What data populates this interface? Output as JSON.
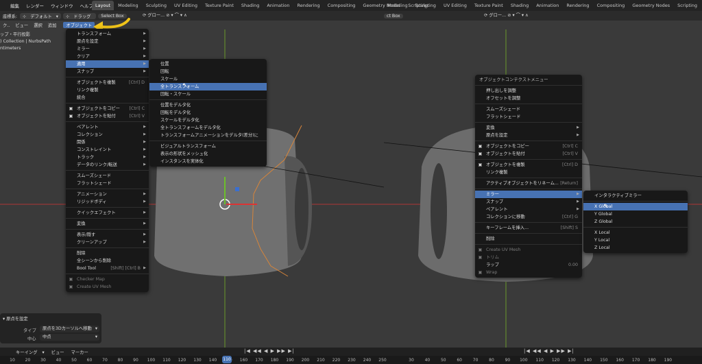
{
  "topmenu": [
    "",
    "編集",
    "レンダー",
    "ウィンドウ",
    "ヘルプ"
  ],
  "tabs": [
    "Layout",
    "Modeling",
    "Sculpting",
    "UV Editing",
    "Texture Paint",
    "Shading",
    "Animation",
    "Rendering",
    "Compositing",
    "Geometry Nodes",
    "Scripting"
  ],
  "tabs_right": [
    "Modeling",
    "Sculpting",
    "UV Editing",
    "Texture Paint",
    "Shading",
    "Animation",
    "Rendering",
    "Compositing",
    "Geometry Nodes",
    "Scripting"
  ],
  "header": {
    "coord": "座標系:",
    "pivot": "デフォルト",
    "drag": "ドラッグ",
    "select": "Select Box",
    "select_right": "ct Box",
    "global": "グロー...",
    "global2": "グロー..."
  },
  "header2": {
    "view_prefix": "ク..",
    "view": "ビュー",
    "select": "選択",
    "add": "追加",
    "object": "オブジェクト"
  },
  "viewinfo": {
    "line1": "ップ・平行投影",
    "line2": ") Collection | NurbsPath",
    "line3": "ntimeters"
  },
  "menu_object": {
    "items": [
      {
        "label": "トランスフォーム",
        "sub": true
      },
      {
        "label": "原点を設定",
        "sub": true
      },
      {
        "label": "ミラー",
        "sub": true
      },
      {
        "label": "クリア",
        "sub": true
      },
      {
        "label": "適用",
        "sub": true,
        "hl": true
      },
      {
        "label": "スナップ",
        "sub": true
      },
      {
        "sep": true
      },
      {
        "label": "オブジェクトを複製",
        "sc": "[Ctrl] D"
      },
      {
        "label": "リンク複製"
      },
      {
        "label": "統合"
      },
      {
        "sep": true
      },
      {
        "label": "オブジェクトをコピー",
        "sc": "[Ctrl] C",
        "icon": true
      },
      {
        "label": "オブジェクトを貼付",
        "sc": "[Ctrl] V",
        "icon": true
      },
      {
        "sep": true
      },
      {
        "label": "ペアレント",
        "sub": true
      },
      {
        "label": "コレクション",
        "sub": true
      },
      {
        "label": "関係",
        "sub": true
      },
      {
        "label": "コンストレイント",
        "sub": true
      },
      {
        "label": "トラック",
        "sub": true
      },
      {
        "label": "データのリンク/転送",
        "sub": true
      },
      {
        "sep": true
      },
      {
        "label": "スムーズシェード"
      },
      {
        "label": "フラットシェード"
      },
      {
        "sep": true
      },
      {
        "label": "アニメーション",
        "sub": true
      },
      {
        "label": "リジッドボディ",
        "sub": true
      },
      {
        "sep": true
      },
      {
        "label": "クイックエフェクト",
        "sub": true
      },
      {
        "sep": true
      },
      {
        "label": "変換",
        "sub": true
      },
      {
        "sep": true
      },
      {
        "label": "表示/隠す",
        "sub": true
      },
      {
        "label": "クリーンアップ",
        "sub": true
      },
      {
        "sep": true
      },
      {
        "label": "削除"
      },
      {
        "label": "全シーンから削除"
      },
      {
        "label": "Bool Tool",
        "sc": "[Shift] [Ctrl] B",
        "sub": true
      },
      {
        "sep": true
      },
      {
        "label": "Checker Map",
        "dim": true,
        "icon": true
      },
      {
        "label": "Create UV Mesh",
        "dim": true,
        "icon": true
      }
    ]
  },
  "menu_apply": {
    "items": [
      {
        "label": "位置"
      },
      {
        "label": "回転"
      },
      {
        "label": "スケール"
      },
      {
        "label": "全トランスフォーム",
        "hl": true
      },
      {
        "label": "回転・スケール"
      },
      {
        "sep": true
      },
      {
        "label": "位置をデルタ化"
      },
      {
        "label": "回転をデルタ化"
      },
      {
        "label": "スケールをデルタ化"
      },
      {
        "label": "全トランスフォームをデルタ化"
      },
      {
        "label": "トランスフォームアニメーションをデルタ(差分)に"
      },
      {
        "sep": true
      },
      {
        "label": "ビジュアルトランスフォーム"
      },
      {
        "label": "表示の形状をメッシュ化"
      },
      {
        "label": "インスタンスを実体化"
      }
    ]
  },
  "menu_context": {
    "title": "オブジェクトコンテクストメニュー",
    "items": [
      {
        "label": "押し出しを調整"
      },
      {
        "label": "オフセットを調整"
      },
      {
        "sep": true
      },
      {
        "label": "スムーズシェード"
      },
      {
        "label": "フラットシェード"
      },
      {
        "sep": true
      },
      {
        "label": "変換",
        "sub": true
      },
      {
        "label": "原点を設定",
        "sub": true
      },
      {
        "sep": true
      },
      {
        "label": "オブジェクトをコピー",
        "sc": "[Ctrl] C",
        "icon": true
      },
      {
        "label": "オブジェクトを貼付",
        "sc": "[Ctrl] V",
        "icon": true
      },
      {
        "sep": true
      },
      {
        "label": "オブジェクトを複製",
        "sc": "[Ctrl] D",
        "icon": true
      },
      {
        "label": "リンク複製"
      },
      {
        "sep": true
      },
      {
        "label": "アクティブオブジェクトをリネーム...",
        "sc": "[Return]"
      },
      {
        "sep": true
      },
      {
        "label": "ミラー",
        "sub": true,
        "hl": true
      },
      {
        "label": "スナップ",
        "sub": true
      },
      {
        "label": "ペアレント",
        "sub": true
      },
      {
        "label": "コレクションに移動",
        "sc": "[Ctrl] G"
      },
      {
        "sep": true
      },
      {
        "label": "キーフレームを挿入...",
        "sc": "[Shift] S"
      },
      {
        "sep": true
      },
      {
        "label": "削除"
      },
      {
        "sep": true
      },
      {
        "label": "Create UV Mesh",
        "dim": true,
        "icon": true
      },
      {
        "label": "トリム",
        "dim": true,
        "icon": true
      },
      {
        "label": "ラップ",
        "sc": "0.00"
      },
      {
        "label": "Wrap",
        "dim": true,
        "icon": true
      }
    ]
  },
  "menu_mirror": {
    "items": [
      {
        "label": "インタラクティブミラー"
      },
      {
        "sep": true
      },
      {
        "label": "X Global",
        "hl": true
      },
      {
        "label": "Y Global"
      },
      {
        "label": "Z Global"
      },
      {
        "sep": true
      },
      {
        "label": "X Local"
      },
      {
        "label": "Y Local"
      },
      {
        "label": "Z Local"
      }
    ]
  },
  "operator": {
    "title": "原点を設定",
    "type_label": "タイプ",
    "type_value": "原点を3Dカーソルへ移動",
    "center_label": "中心",
    "center_value": "中点"
  },
  "timeline": {
    "keying": "キーイング",
    "view": "ビュー",
    "marker": "マーカー"
  },
  "frames_left": [
    "10",
    "20",
    "30",
    "40",
    "50",
    "60",
    "70",
    "80",
    "90",
    "100",
    "110",
    "120",
    "130",
    "140",
    "150",
    "160",
    "170",
    "180",
    "190",
    "200",
    "210",
    "220",
    "230",
    "240",
    "250"
  ],
  "frames_right": [
    "30",
    "40",
    "50",
    "60",
    "70",
    "80",
    "90",
    "100",
    "110",
    "120",
    "130",
    "140",
    "150",
    "160",
    "170",
    "180",
    "190"
  ],
  "colors": {
    "highlight": "#4772b3",
    "arrow": "#f0c419",
    "axis_red": "#c0393b",
    "axis_green": "#6a9b2a"
  }
}
